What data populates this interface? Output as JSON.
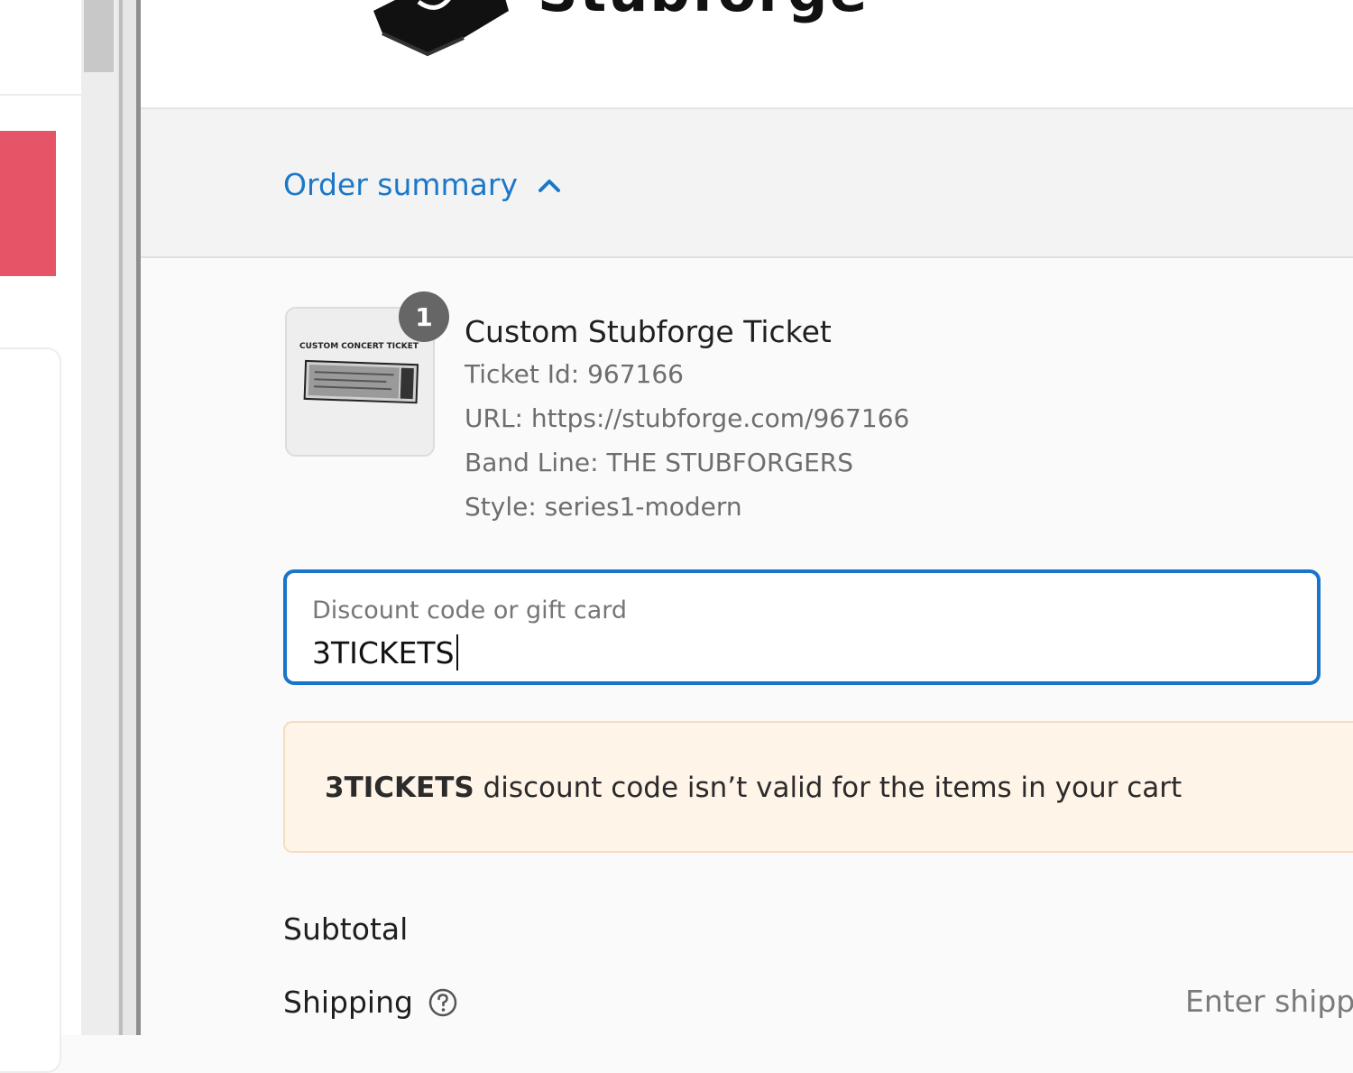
{
  "header": {
    "brand_text": "Stubforge"
  },
  "summary": {
    "toggle_label": "Order summary",
    "toggle_icon": "chevron-up-icon"
  },
  "item": {
    "quantity": "1",
    "title": "Custom Stubforge Ticket",
    "thumbnail_caption": "CUSTOM CONCERT TICKET",
    "properties": [
      "Ticket Id: 967166",
      "URL: https://stubforge.com/967166",
      "Band Line: THE STUBFORGERS",
      "Style: series1-modern"
    ]
  },
  "discount": {
    "label": "Discount code or gift card",
    "value": "3TICKETS"
  },
  "notice": {
    "code": "3TICKETS",
    "message": " discount code isn’t valid for the items in your cart"
  },
  "totals": {
    "subtotal_label": "Subtotal",
    "shipping_label": "Shipping",
    "shipping_value": "Enter shippi"
  },
  "colors": {
    "link_blue": "#1b78c8",
    "focus_blue": "#1a74c9",
    "notice_bg": "#fff4e8",
    "left_accent": "#e55467"
  }
}
